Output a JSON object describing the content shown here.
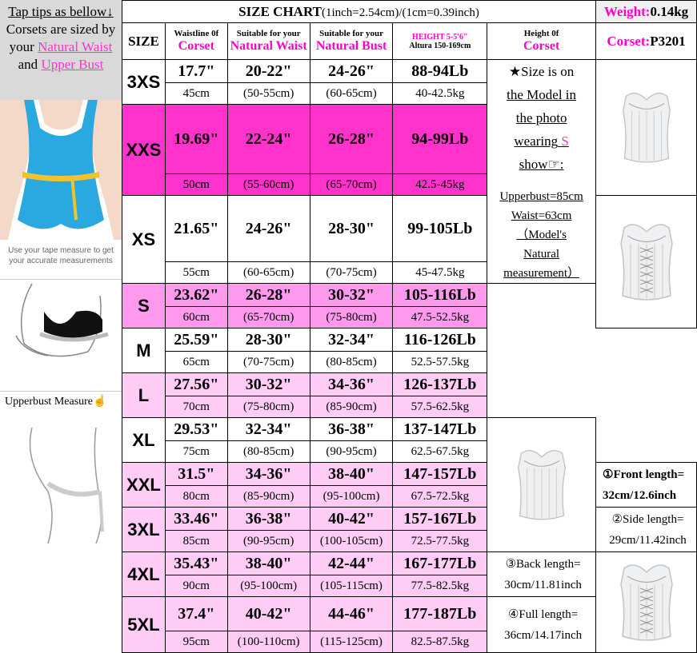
{
  "tips": {
    "line1": "Tap tips as bellow↓",
    "line2": "Corsets are sized by",
    "line3_pre": "your",
    "line3_link": "Natural Waist",
    "line4_pre": "and",
    "line4_link": "Upper Bust",
    "tape_caption": "Use your tape measure to get your accurate measurements",
    "upperbust_label": "Upperbust Measure☝"
  },
  "header": {
    "title": "SIZE CHART",
    "title_conv": "(1inch=2.54cm)/(1cm=0.39inch)",
    "weight_label": "Weight:",
    "weight_value": "0.14kg",
    "size": "SIZE",
    "waistline_of": "Waistline 0f",
    "corset": "Corset",
    "suitable1": "Suitable for your",
    "natural_waist": "Natural Waist",
    "suitable2": "Suitable for your",
    "natural_bust": "Natural Bust",
    "height_label": "HEIGHT 5-5'6\"",
    "altura": "Altura 150-169cm",
    "height_of": "Height 0f",
    "corset2": "Corset",
    "corset_code_label": "Corset:",
    "corset_code": "P3201"
  },
  "rows": [
    {
      "size": "3XS",
      "waist_in": "17.7\"",
      "waist_cm": "45cm",
      "nw_in": "20-22\"",
      "nw_cm": "(50-55cm)",
      "nb_in": "24-26\"",
      "nb_cm": "(60-65cm)",
      "lb": "88-94Lb",
      "kg": "40-42.5kg"
    },
    {
      "size": "XXS",
      "waist_in": "19.69\"",
      "waist_cm": "50cm",
      "nw_in": "22-24\"",
      "nw_cm": "(55-60cm)",
      "nb_in": "26-28\"",
      "nb_cm": "(65-70cm)",
      "lb": "94-99Lb",
      "kg": "42.5-45kg"
    },
    {
      "size": "XS",
      "waist_in": "21.65\"",
      "waist_cm": "55cm",
      "nw_in": "24-26\"",
      "nw_cm": "(60-65cm)",
      "nb_in": "28-30\"",
      "nb_cm": "(70-75cm)",
      "lb": "99-105Lb",
      "kg": "45-47.5kg"
    },
    {
      "size": "S",
      "waist_in": "23.62\"",
      "waist_cm": "60cm",
      "nw_in": "26-28\"",
      "nw_cm": "(65-70cm)",
      "nb_in": "30-32\"",
      "nb_cm": "(75-80cm)",
      "lb": "105-116Lb",
      "kg": "47.5-52.5kg"
    },
    {
      "size": "M",
      "waist_in": "25.59\"",
      "waist_cm": "65cm",
      "nw_in": "28-30\"",
      "nw_cm": "(70-75cm)",
      "nb_in": "32-34\"",
      "nb_cm": "(80-85cm)",
      "lb": "116-126Lb",
      "kg": "52.5-57.5kg"
    },
    {
      "size": "L",
      "waist_in": "27.56\"",
      "waist_cm": "70cm",
      "nw_in": "30-32\"",
      "nw_cm": "(75-80cm)",
      "nb_in": "34-36\"",
      "nb_cm": "(85-90cm)",
      "lb": "126-137Lb",
      "kg": "57.5-62.5kg"
    },
    {
      "size": "XL",
      "waist_in": "29.53\"",
      "waist_cm": "75cm",
      "nw_in": "32-34\"",
      "nw_cm": "(80-85cm)",
      "nb_in": "36-38\"",
      "nb_cm": "(90-95cm)",
      "lb": "137-147Lb",
      "kg": "62.5-67.5kg"
    },
    {
      "size": "XXL",
      "waist_in": "31.5\"",
      "waist_cm": "80cm",
      "nw_in": "34-36\"",
      "nw_cm": "(85-90cm)",
      "nb_in": "38-40\"",
      "nb_cm": "(95-100cm)",
      "lb": "147-157Lb",
      "kg": "67.5-72.5kg"
    },
    {
      "size": "3XL",
      "waist_in": "33.46\"",
      "waist_cm": "85cm",
      "nw_in": "36-38\"",
      "nw_cm": "(90-95cm)",
      "nb_in": "40-42\"",
      "nb_cm": "(100-105cm)",
      "lb": "157-167Lb",
      "kg": "72.5-77.5kg"
    },
    {
      "size": "4XL",
      "waist_in": "35.43\"",
      "waist_cm": "90cm",
      "nw_in": "38-40\"",
      "nw_cm": "(95-100cm)",
      "nb_in": "42-44\"",
      "nb_cm": "(105-115cm)",
      "lb": "167-177Lb",
      "kg": "77.5-82.5kg"
    },
    {
      "size": "5XL",
      "waist_in": "37.4\"",
      "waist_cm": "95cm",
      "nw_in": "40-42\"",
      "nw_cm": "(100-110cm)",
      "nb_in": "44-46\"",
      "nb_cm": "(115-125cm)",
      "lb": "177-187Lb",
      "kg": "82.5-87.5kg"
    }
  ],
  "row_styles": [
    "white",
    "pinkA",
    "white",
    "pinkB",
    "white",
    "pinkC",
    "white",
    "pinkC",
    "pinkC",
    "pinkC",
    "pinkC"
  ],
  "model_note": {
    "l1": "★Size is on",
    "l2": "the Model in",
    "l3": "the photo",
    "l4_pre": "wearing",
    "l4_size": "S",
    "l5": "show☞:"
  },
  "model_meas": {
    "upperbust": "Upperbust=85cm",
    "waist": "Waist=63cm",
    "l3": "（Model's",
    "l4": "Natural",
    "l5": "measurement）"
  },
  "lengths": {
    "front_a": "①Front length=",
    "front_b": "32cm/12.6inch",
    "side_a": "②Side length=",
    "side_b": "29cm/11.42inch",
    "back_a": "③Back length=",
    "back_b": "30cm/11.81inch",
    "full_a": "④Full length=",
    "full_b": "36cm/14.17inch"
  },
  "colors": {
    "pink_strong": "#ff33cc",
    "pink_mid": "#ff99ee",
    "pink_light": "#ffccf5",
    "accent_text": "#ff00cc",
    "swimsuit": "#29a9e0",
    "tape": "#f2c230"
  }
}
